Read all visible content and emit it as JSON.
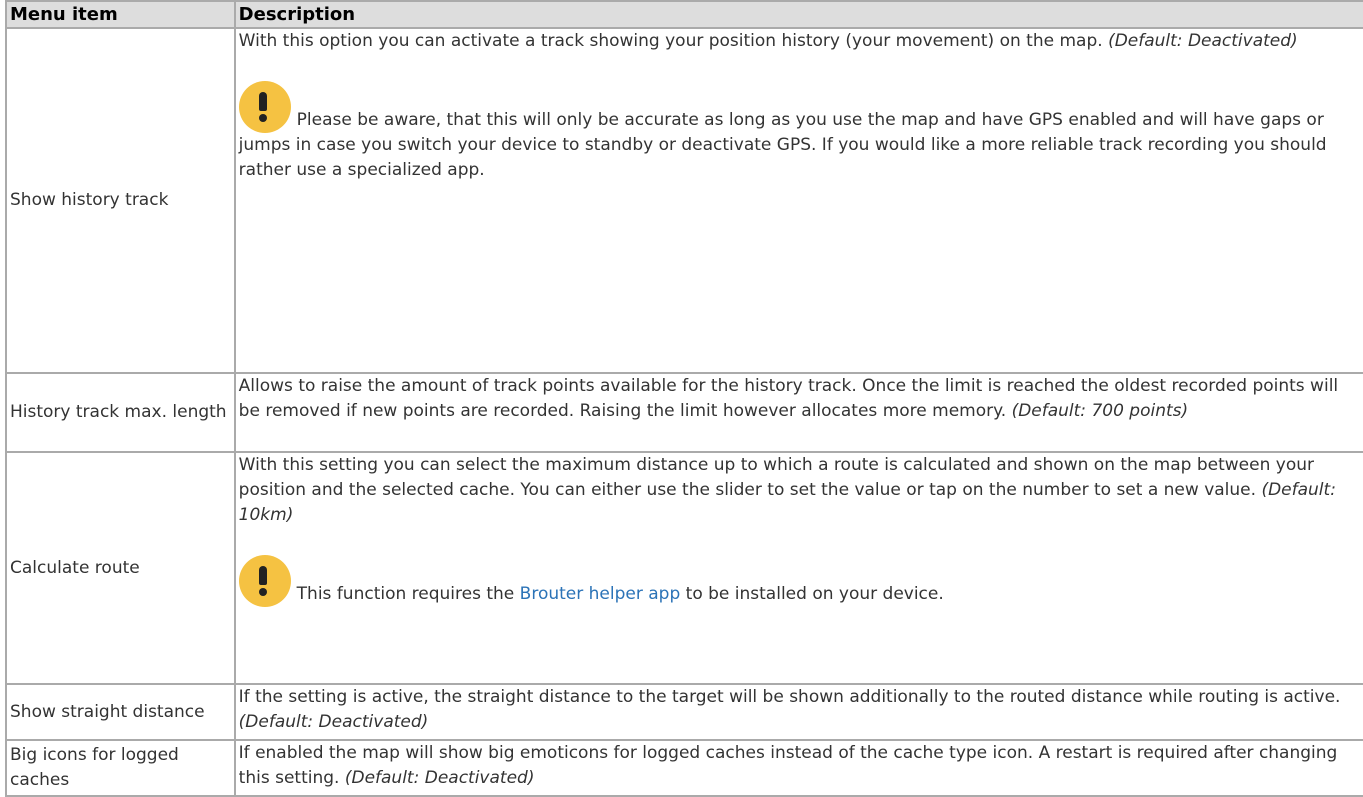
{
  "table": {
    "headers": [
      "Menu item",
      "Description"
    ],
    "rows": [
      {
        "name": "Show history track",
        "desc": "With this option you can activate a track showing your position history (your movement) on the map.",
        "default": "(Default: Deactivated)",
        "note": "Please be aware, that this will only be accurate as long as you use the map and have GPS enabled and will have gaps or jumps in case you switch your device to standby or deactivate GPS. If you would like a more reliable track recording you should rather use a specialized app.",
        "note_icon": "warning-exclamation-icon"
      },
      {
        "name": "History track max. length",
        "desc": "Allows to raise the amount of track points available for the history track. Once the limit is reached the oldest recorded points will be removed if new points are recorded. Raising the limit however allocates more memory.",
        "default": "(Default: 700 points)"
      },
      {
        "name": "Calculate route",
        "desc": "With this setting you can select the maximum distance up to which a route is calculated and shown on the map between your position and the selected cache. You can either use the slider to set the value or tap on the number to set a new value.",
        "default": "(Default: 10km)",
        "note_before": "This function requires the",
        "note_link": "Brouter helper app",
        "note_after": "to be installed on your device.",
        "note_icon": "warning-exclamation-icon"
      },
      {
        "name": "Show straight distance",
        "desc": "If the setting is active, the straight distance to the target will be shown additionally to the routed distance while routing is active.",
        "default": "(Default: Deactivated)"
      },
      {
        "name": "Big icons for logged caches",
        "desc": "If enabled the map will show big emoticons for logged caches instead of the cache type icon. A restart is required after changing this setting.",
        "default": "(Default: Deactivated)"
      }
    ]
  },
  "colors": {
    "header_bg": "#dddddd",
    "border": "#aaaaaa",
    "text": "#333333",
    "link": "#2b73b7",
    "warning_icon": "#f5c242"
  }
}
